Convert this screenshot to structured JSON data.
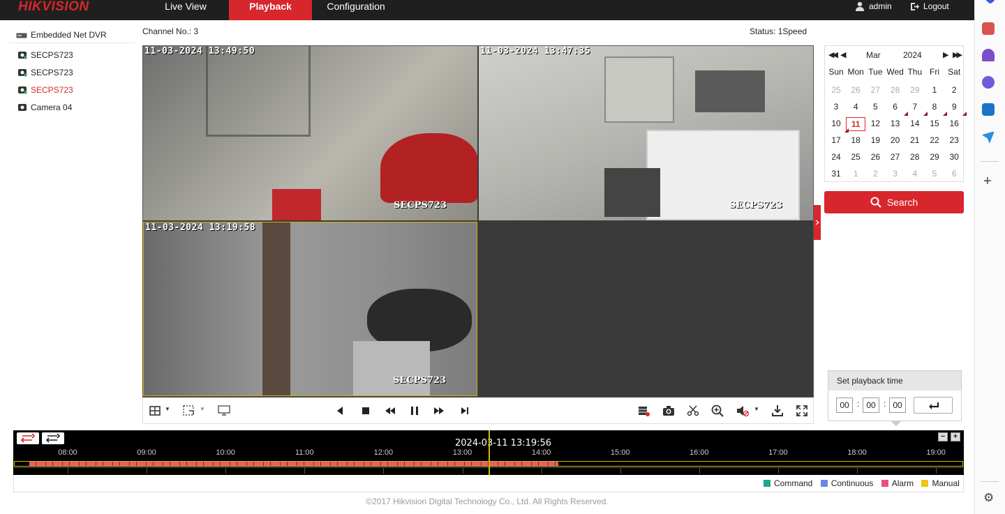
{
  "brand": "HIKVISION",
  "nav": {
    "tabs": [
      {
        "label": "Live View"
      },
      {
        "label": "Playback"
      },
      {
        "label": "Configuration"
      }
    ],
    "active_tab": "Playback",
    "user": "admin",
    "logout": "Logout"
  },
  "tree": {
    "device": "Embedded Net DVR",
    "channels": [
      {
        "label": "SECPS723",
        "icon": "camera-recording-icon"
      },
      {
        "label": "SECPS723",
        "icon": "camera-recording-icon"
      },
      {
        "label": "SECPS723",
        "icon": "camera-recording-icon",
        "active": true
      },
      {
        "label": "Camera 04",
        "icon": "camera-icon"
      }
    ]
  },
  "info": {
    "channel": "Channel No.: 3",
    "status": "Status: 1Speed"
  },
  "video": {
    "panes": [
      {
        "timestamp": "11-03-2024 13:49:50",
        "osd": "SECPS723"
      },
      {
        "timestamp": "11-03-2024 13:47:35",
        "osd": "SECPS723"
      },
      {
        "timestamp": "11-03-2024 13:19:58",
        "osd": "SECPS723"
      },
      {
        "timestamp": "",
        "osd": ""
      }
    ]
  },
  "calendar": {
    "month": "Mar",
    "year": "2024",
    "weekdays": [
      "Sun",
      "Mon",
      "Tue",
      "Wed",
      "Thu",
      "Fri",
      "Sat"
    ],
    "weeks": [
      [
        "25",
        "26",
        "27",
        "28",
        "29",
        "1",
        "2"
      ],
      [
        "3",
        "4",
        "5",
        "6",
        "7",
        "8",
        "9"
      ],
      [
        "10",
        "11",
        "12",
        "13",
        "14",
        "15",
        "16"
      ],
      [
        "17",
        "18",
        "19",
        "20",
        "21",
        "22",
        "23"
      ],
      [
        "24",
        "25",
        "26",
        "27",
        "28",
        "29",
        "30"
      ],
      [
        "31",
        "1",
        "2",
        "3",
        "4",
        "5",
        "6"
      ]
    ],
    "selected": "11",
    "recorded_days": [
      "6",
      "7",
      "8",
      "9",
      "10"
    ]
  },
  "search_label": "Search",
  "playback_time": {
    "title": "Set playback time",
    "hh": "00",
    "mm": "00",
    "ss": "00"
  },
  "timeline": {
    "current": "2024-03-11 13:19:56",
    "ticks": [
      "08:00",
      "09:00",
      "10:00",
      "11:00",
      "12:00",
      "13:00",
      "14:00",
      "15:00",
      "16:00",
      "17:00",
      "18:00",
      "19:00"
    ],
    "record_start": "07:30",
    "record_end": "14:12"
  },
  "legend": [
    {
      "label": "Command",
      "color": "#1aa889"
    },
    {
      "label": "Continuous",
      "color": "#6a86e8"
    },
    {
      "label": "Alarm",
      "color": "#e9517b"
    },
    {
      "label": "Manual",
      "color": "#f0c419"
    }
  ],
  "footer": "©2017 Hikvision Digital Technology Co., Ltd. All Rights Reserved.",
  "colors": {
    "accent": "#d7262c",
    "recording": "#e86060",
    "timeline_bar": "#d4b800"
  }
}
